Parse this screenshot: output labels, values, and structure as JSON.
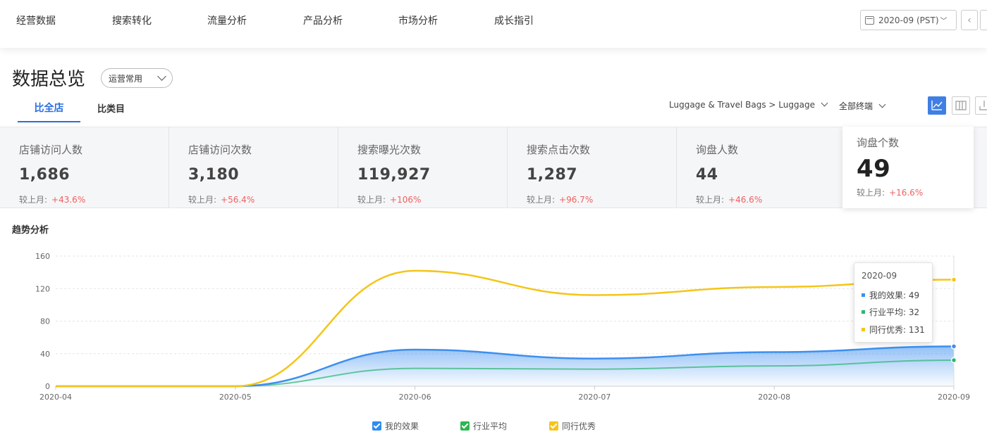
{
  "nav": {
    "items": [
      "经营数据",
      "搜索转化",
      "流量分析",
      "产品分析",
      "市场分析",
      "成长指引"
    ],
    "date": "2020-09 (PST)",
    "prev": "‹"
  },
  "header": {
    "title": "数据总览",
    "preset": "运营常用",
    "tabs": [
      "比全店",
      "比类目"
    ],
    "category": "Luggage & Travel Bags > Luggage",
    "terminal": "全部终端"
  },
  "metrics": [
    {
      "label": "店铺访问人数",
      "value": "1,686",
      "cmp_label": "较上月:",
      "cmp": "+43.6%"
    },
    {
      "label": "店铺访问次数",
      "value": "3,180",
      "cmp_label": "较上月:",
      "cmp": "+56.4%"
    },
    {
      "label": "搜索曝光次数",
      "value": "119,927",
      "cmp_label": "较上月:",
      "cmp": "+106%"
    },
    {
      "label": "搜索点击次数",
      "value": "1,287",
      "cmp_label": "较上月:",
      "cmp": "+96.7%"
    },
    {
      "label": "询盘人数",
      "value": "44",
      "cmp_label": "较上月:",
      "cmp": "+46.6%"
    },
    {
      "label": "询盘个数",
      "value": "49",
      "cmp_label": "较上月:",
      "cmp": "+16.6%"
    }
  ],
  "section_title": "趋势分析",
  "chart_data": {
    "type": "line",
    "categories": [
      "2020-04",
      "2020-05",
      "2020-06",
      "2020-07",
      "2020-08",
      "2020-09"
    ],
    "ylim": [
      0,
      160
    ],
    "yticks": [
      0,
      40,
      80,
      120,
      160
    ],
    "grid": true,
    "legend_position": "bottom",
    "series": [
      {
        "name": "我的效果",
        "values": [
          0,
          0,
          45,
          34,
          42,
          49
        ],
        "color": "#3c8ff0",
        "area": true
      },
      {
        "name": "行业平均",
        "values": [
          0,
          0,
          22,
          21,
          25,
          32
        ],
        "color": "#2bb673"
      },
      {
        "name": "同行优秀",
        "values": [
          0,
          0,
          142,
          112,
          122,
          131
        ],
        "color": "#f5c518"
      }
    ]
  },
  "tooltip": {
    "title": "2020-09",
    "rows": [
      {
        "label": "我的效果: 49",
        "color": "#3c8ff0"
      },
      {
        "label": "行业平均: 32",
        "color": "#2bb673"
      },
      {
        "label": "同行优秀: 131",
        "color": "#f5c518"
      }
    ]
  },
  "legend": [
    {
      "label": "我的效果",
      "color": "#2e8cf0"
    },
    {
      "label": "行业平均",
      "color": "#2bb650"
    },
    {
      "label": "同行优秀",
      "color": "#f5c518"
    }
  ]
}
